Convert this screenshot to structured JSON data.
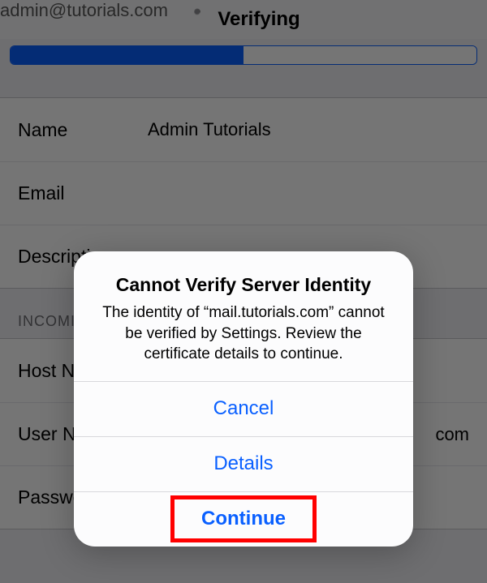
{
  "header": {
    "title": "Verifying"
  },
  "form": {
    "rows": [
      {
        "label": "Name",
        "value": "Admin Tutorials"
      },
      {
        "label": "Email",
        "value": "admin@tutorials.com"
      },
      {
        "label": "Description",
        "value": ""
      }
    ]
  },
  "section_incoming": "INCOMING MAIL SERVER",
  "server": {
    "rows": [
      {
        "label": "Host Name",
        "value": ""
      },
      {
        "label": "User Name",
        "value": "com"
      },
      {
        "label": "Password",
        "value": ""
      }
    ]
  },
  "alert": {
    "title": "Cannot Verify Server Identity",
    "message": "The identity of “mail.tutorials.com” cannot be verified by Settings. Review the certificate details to continue.",
    "cancel": "Cancel",
    "details": "Details",
    "continue": "Continue"
  }
}
